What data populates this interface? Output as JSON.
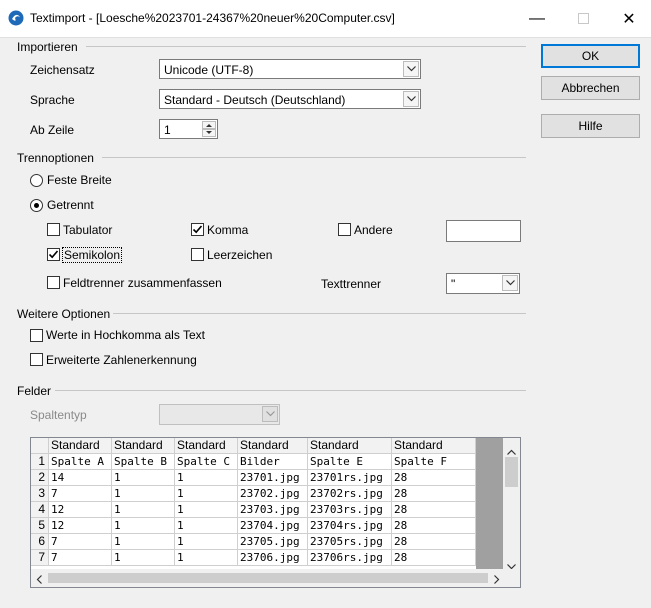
{
  "window": {
    "title": "Textimport - [Loesche%2023701-24367%20neuer%20Computer.csv]",
    "icons": {
      "app": "libreoffice-icon",
      "minimize": "minimize-icon",
      "maximize": "maximize-icon",
      "close": "close-icon"
    }
  },
  "import": {
    "section_label": "Importieren",
    "charset_label": "Zeichensatz",
    "charset_value": "Unicode (UTF-8)",
    "language_label": "Sprache",
    "language_value": "Standard - Deutsch (Deutschland)",
    "from_row_label": "Ab Zeile",
    "from_row_value": "1"
  },
  "separator_options": {
    "section_label": "Trennoptionen",
    "fixed_width_label": "Feste Breite",
    "fixed_width_selected": false,
    "separated_label": "Getrennt",
    "separated_selected": true,
    "tab_label": "Tabulator",
    "tab_checked": false,
    "comma_label": "Komma",
    "comma_checked": true,
    "other_label": "Andere",
    "other_checked": false,
    "other_value": "",
    "semicolon_label": "Semikolon",
    "semicolon_checked": true,
    "space_label": "Leerzeichen",
    "space_checked": false,
    "merge_label": "Feldtrenner zusammenfassen",
    "merge_checked": false,
    "string_delimiter_label": "Texttrenner",
    "string_delimiter_value": "\""
  },
  "other_options": {
    "section_label": "Weitere Optionen",
    "quoted_as_text_label": "Werte in Hochkomma als Text",
    "quoted_as_text_checked": false,
    "detect_numbers_label": "Erweiterte Zahlenerkennung",
    "detect_numbers_checked": false
  },
  "fields": {
    "section_label": "Felder",
    "column_type_label": "Spaltentyp",
    "column_type_value": "",
    "column_headers": [
      "Standard",
      "Standard",
      "Standard",
      "Standard",
      "Standard",
      "Standard"
    ],
    "row_numbers": [
      "1",
      "2",
      "3",
      "4",
      "5",
      "6",
      "7"
    ],
    "rows": [
      [
        "Spalte A",
        "Spalte B",
        "Spalte C",
        "Bilder",
        "Spalte E",
        "Spalte F"
      ],
      [
        "14",
        "1",
        "1",
        "23701.jpg",
        "23701rs.jpg",
        "28"
      ],
      [
        "7",
        "1",
        "1",
        "23702.jpg",
        "23702rs.jpg",
        "28"
      ],
      [
        "12",
        "1",
        "1",
        "23703.jpg",
        "23703rs.jpg",
        "28"
      ],
      [
        "12",
        "1",
        "1",
        "23704.jpg",
        "23704rs.jpg",
        "28"
      ],
      [
        "7",
        "1",
        "1",
        "23705.jpg",
        "23705rs.jpg",
        "28"
      ],
      [
        "7",
        "1",
        "1",
        "23706.jpg",
        "23706rs.jpg",
        "28"
      ]
    ]
  },
  "buttons": {
    "ok": "OK",
    "cancel": "Abbrechen",
    "help": "Hilfe"
  },
  "colors": {
    "accent": "#0078d7",
    "dialog_bg": "#f0f0f0"
  }
}
